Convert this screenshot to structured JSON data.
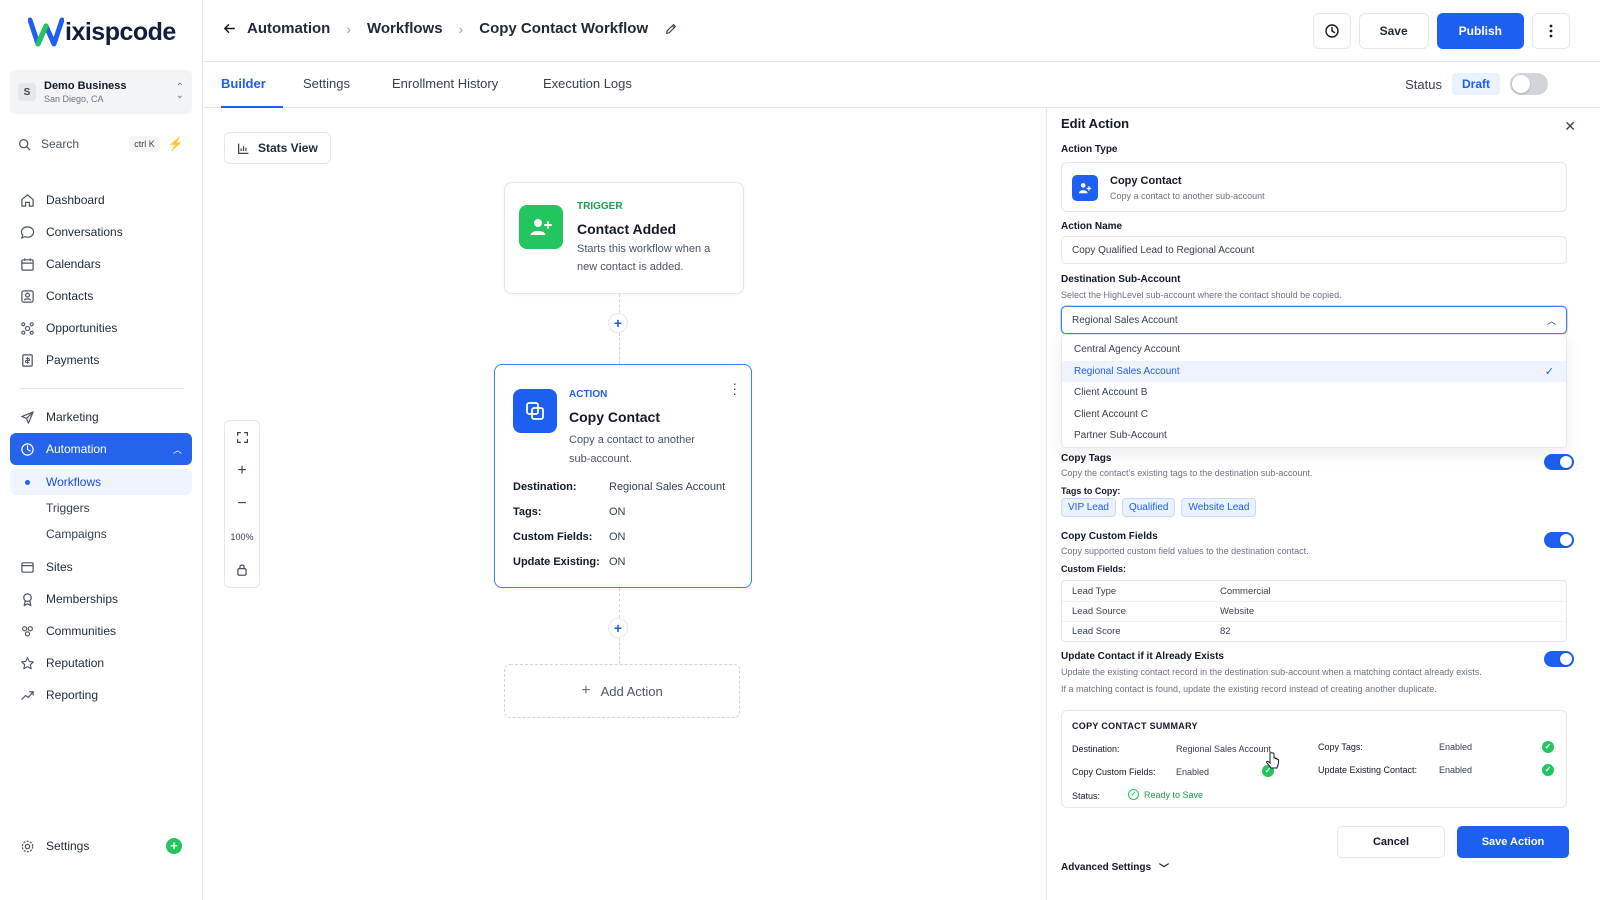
{
  "brand": {
    "logo_text": "ixispcode",
    "logo_letter": "W"
  },
  "business": {
    "initial": "S",
    "name": "Demo Business",
    "location": "San Diego, CA"
  },
  "search": {
    "label": "Search",
    "shortcut": "ctrl K"
  },
  "nav": {
    "items": [
      {
        "label": "Dashboard",
        "icon": "home-icon"
      },
      {
        "label": "Conversations",
        "icon": "chat-icon"
      },
      {
        "label": "Calendars",
        "icon": "calendar-icon"
      },
      {
        "label": "Contacts",
        "icon": "contacts-icon"
      },
      {
        "label": "Opportunities",
        "icon": "opportunities-icon"
      },
      {
        "label": "Payments",
        "icon": "payments-icon"
      }
    ],
    "marketing": "Marketing",
    "automation": "Automation",
    "automation_sub": [
      "Workflows",
      "Triggers",
      "Campaigns"
    ],
    "items2": [
      {
        "label": "Sites",
        "icon": "sites-icon"
      },
      {
        "label": "Memberships",
        "icon": "memberships-icon"
      },
      {
        "label": "Communities",
        "icon": "communities-icon"
      },
      {
        "label": "Reputation",
        "icon": "star-icon"
      },
      {
        "label": "Reporting",
        "icon": "reporting-icon"
      }
    ],
    "settings": "Settings"
  },
  "header": {
    "crumbs": [
      "Automation",
      "Workflows"
    ],
    "current": "Copy Contact Workflow",
    "save": "Save",
    "publish": "Publish"
  },
  "tabs": {
    "items": [
      "Builder",
      "Settings",
      "Enrollment History",
      "Execution Logs"
    ],
    "status_label": "Status",
    "status_value": "Draft"
  },
  "canvas": {
    "stats_view": "Stats View",
    "zoom": "100%",
    "trigger": {
      "eyebrow": "TRIGGER",
      "title": "Contact Added",
      "desc_1": "Starts this workflow when a",
      "desc_2": "new contact is added."
    },
    "action": {
      "eyebrow": "ACTION",
      "title": "Copy Contact",
      "desc_1": "Copy a contact to another",
      "desc_2": "sub-account.",
      "rows": [
        {
          "k": "Destination:",
          "v": "Regional Sales Account"
        },
        {
          "k": "Tags:",
          "v": "ON"
        },
        {
          "k": "Custom Fields:",
          "v": "ON"
        },
        {
          "k": "Update Existing:",
          "v": "ON"
        }
      ]
    },
    "add_action": "Add Action"
  },
  "panel": {
    "title": "Edit Action",
    "action_type_label": "Action Type",
    "action_type_title": "Copy Contact",
    "action_type_desc": "Copy a contact to another sub-account",
    "action_name_label": "Action Name",
    "action_name_value": "Copy Qualified Lead to Regional Account",
    "dest_label": "Destination Sub-Account",
    "dest_help": "Select the HighLevel sub-account where the contact should be copied.",
    "dest_value": "Regional Sales Account",
    "dest_options": [
      "Central Agency Account",
      "Regional Sales Account",
      "Client Account B",
      "Client Account C",
      "Partner Sub-Account"
    ],
    "copy_tags_label": "Copy Tags",
    "copy_tags_help": "Copy the contact's existing tags to the destination sub-account.",
    "tags_to_copy_label": "Tags to Copy:",
    "tags": [
      "VIP Lead",
      "Qualified",
      "Website Lead"
    ],
    "copy_cf_label": "Copy Custom Fields",
    "copy_cf_help": "Copy supported custom field values to the destination contact.",
    "cf_label": "Custom Fields:",
    "cf_rows": [
      {
        "name": "Lead Type",
        "value": "Commercial"
      },
      {
        "name": "Lead Source",
        "value": "Website"
      },
      {
        "name": "Lead Score",
        "value": "82"
      }
    ],
    "update_label": "Update Contact if it Already Exists",
    "update_help_1": "Update the existing contact record in the destination sub-account when a matching contact already exists.",
    "update_help_2": "If a matching contact is found, update the existing record instead of creating another duplicate.",
    "summary": {
      "title": "COPY CONTACT SUMMARY",
      "destination_k": "Destination:",
      "destination_v": "Regional Sales Account",
      "copy_tags_k": "Copy Tags:",
      "copy_tags_v": "Enabled",
      "copy_cf_k": "Copy Custom Fields:",
      "copy_cf_v": "Enabled",
      "update_k": "Update Existing Contact:",
      "update_v": "Enabled",
      "status_k": "Status:",
      "status_v": "Ready to Save"
    },
    "cancel": "Cancel",
    "save_action": "Save Action",
    "advanced": "Advanced Settings"
  },
  "colors": {
    "accent": "#1d5ff0",
    "success": "#22c55e"
  }
}
